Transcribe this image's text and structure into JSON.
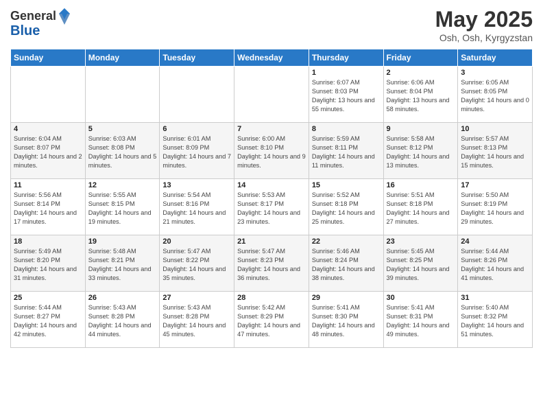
{
  "header": {
    "logo": {
      "general": "General",
      "blue": "Blue"
    },
    "title": "May 2025",
    "subtitle": "Osh, Osh, Kyrgyzstan"
  },
  "weekdays": [
    "Sunday",
    "Monday",
    "Tuesday",
    "Wednesday",
    "Thursday",
    "Friday",
    "Saturday"
  ],
  "weeks": [
    [
      {
        "day": "",
        "info": ""
      },
      {
        "day": "",
        "info": ""
      },
      {
        "day": "",
        "info": ""
      },
      {
        "day": "",
        "info": ""
      },
      {
        "day": "1",
        "info": "Sunrise: 6:07 AM\nSunset: 8:03 PM\nDaylight: 13 hours and 55 minutes."
      },
      {
        "day": "2",
        "info": "Sunrise: 6:06 AM\nSunset: 8:04 PM\nDaylight: 13 hours and 58 minutes."
      },
      {
        "day": "3",
        "info": "Sunrise: 6:05 AM\nSunset: 8:05 PM\nDaylight: 14 hours and 0 minutes."
      }
    ],
    [
      {
        "day": "4",
        "info": "Sunrise: 6:04 AM\nSunset: 8:07 PM\nDaylight: 14 hours and 2 minutes."
      },
      {
        "day": "5",
        "info": "Sunrise: 6:03 AM\nSunset: 8:08 PM\nDaylight: 14 hours and 5 minutes."
      },
      {
        "day": "6",
        "info": "Sunrise: 6:01 AM\nSunset: 8:09 PM\nDaylight: 14 hours and 7 minutes."
      },
      {
        "day": "7",
        "info": "Sunrise: 6:00 AM\nSunset: 8:10 PM\nDaylight: 14 hours and 9 minutes."
      },
      {
        "day": "8",
        "info": "Sunrise: 5:59 AM\nSunset: 8:11 PM\nDaylight: 14 hours and 11 minutes."
      },
      {
        "day": "9",
        "info": "Sunrise: 5:58 AM\nSunset: 8:12 PM\nDaylight: 14 hours and 13 minutes."
      },
      {
        "day": "10",
        "info": "Sunrise: 5:57 AM\nSunset: 8:13 PM\nDaylight: 14 hours and 15 minutes."
      }
    ],
    [
      {
        "day": "11",
        "info": "Sunrise: 5:56 AM\nSunset: 8:14 PM\nDaylight: 14 hours and 17 minutes."
      },
      {
        "day": "12",
        "info": "Sunrise: 5:55 AM\nSunset: 8:15 PM\nDaylight: 14 hours and 19 minutes."
      },
      {
        "day": "13",
        "info": "Sunrise: 5:54 AM\nSunset: 8:16 PM\nDaylight: 14 hours and 21 minutes."
      },
      {
        "day": "14",
        "info": "Sunrise: 5:53 AM\nSunset: 8:17 PM\nDaylight: 14 hours and 23 minutes."
      },
      {
        "day": "15",
        "info": "Sunrise: 5:52 AM\nSunset: 8:18 PM\nDaylight: 14 hours and 25 minutes."
      },
      {
        "day": "16",
        "info": "Sunrise: 5:51 AM\nSunset: 8:18 PM\nDaylight: 14 hours and 27 minutes."
      },
      {
        "day": "17",
        "info": "Sunrise: 5:50 AM\nSunset: 8:19 PM\nDaylight: 14 hours and 29 minutes."
      }
    ],
    [
      {
        "day": "18",
        "info": "Sunrise: 5:49 AM\nSunset: 8:20 PM\nDaylight: 14 hours and 31 minutes."
      },
      {
        "day": "19",
        "info": "Sunrise: 5:48 AM\nSunset: 8:21 PM\nDaylight: 14 hours and 33 minutes."
      },
      {
        "day": "20",
        "info": "Sunrise: 5:47 AM\nSunset: 8:22 PM\nDaylight: 14 hours and 35 minutes."
      },
      {
        "day": "21",
        "info": "Sunrise: 5:47 AM\nSunset: 8:23 PM\nDaylight: 14 hours and 36 minutes."
      },
      {
        "day": "22",
        "info": "Sunrise: 5:46 AM\nSunset: 8:24 PM\nDaylight: 14 hours and 38 minutes."
      },
      {
        "day": "23",
        "info": "Sunrise: 5:45 AM\nSunset: 8:25 PM\nDaylight: 14 hours and 39 minutes."
      },
      {
        "day": "24",
        "info": "Sunrise: 5:44 AM\nSunset: 8:26 PM\nDaylight: 14 hours and 41 minutes."
      }
    ],
    [
      {
        "day": "25",
        "info": "Sunrise: 5:44 AM\nSunset: 8:27 PM\nDaylight: 14 hours and 42 minutes."
      },
      {
        "day": "26",
        "info": "Sunrise: 5:43 AM\nSunset: 8:28 PM\nDaylight: 14 hours and 44 minutes."
      },
      {
        "day": "27",
        "info": "Sunrise: 5:43 AM\nSunset: 8:28 PM\nDaylight: 14 hours and 45 minutes."
      },
      {
        "day": "28",
        "info": "Sunrise: 5:42 AM\nSunset: 8:29 PM\nDaylight: 14 hours and 47 minutes."
      },
      {
        "day": "29",
        "info": "Sunrise: 5:41 AM\nSunset: 8:30 PM\nDaylight: 14 hours and 48 minutes."
      },
      {
        "day": "30",
        "info": "Sunrise: 5:41 AM\nSunset: 8:31 PM\nDaylight: 14 hours and 49 minutes."
      },
      {
        "day": "31",
        "info": "Sunrise: 5:40 AM\nSunset: 8:32 PM\nDaylight: 14 hours and 51 minutes."
      }
    ]
  ]
}
